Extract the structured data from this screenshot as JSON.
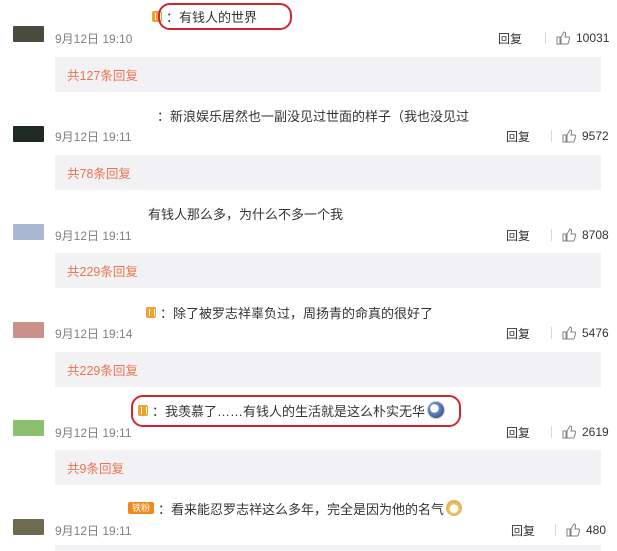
{
  "comments": [
    {
      "text": "：有钱人的世界",
      "badge": "plain",
      "emoji": null,
      "time": "9月12日 19:10",
      "reply": "回复",
      "likes": "10031",
      "more": "共127条回复",
      "avatar_color": "#4a4a3e"
    },
    {
      "text": "：新浪娱乐居然也一副没见过世面的样子（我也没见过",
      "badge": null,
      "emoji": null,
      "time": "9月12日 19:11",
      "reply": "回复",
      "likes": "9572",
      "more": "共78条回复",
      "avatar_color": "#1e2a22"
    },
    {
      "text": "有钱人那么多，为什么不多一个我",
      "badge": null,
      "emoji": null,
      "time": "9月12日 19:11",
      "reply": "回复",
      "likes": "8708",
      "more": "共229条回复",
      "avatar_color": "#a9b6d4"
    },
    {
      "text": "：除了被罗志祥辜负过，周扬青的命真的很好了",
      "badge": "plain",
      "emoji": null,
      "time": "9月12日 19:14",
      "reply": "回复",
      "likes": "5476",
      "more": "共229条回复",
      "avatar_color": "#c9918a"
    },
    {
      "text": "：我羡慕了……有钱人的生活就是这么朴实无华",
      "badge": "plain",
      "emoji": "dog",
      "time": "9月12日 19:11",
      "reply": "回复",
      "likes": "2619",
      "more": "共9条回复",
      "avatar_color": "#8cbf6e"
    },
    {
      "text": "：看来能忍罗志祥这么多年，完全是因为他的名气",
      "badge": "wide",
      "badge_text": "铁粉",
      "emoji": "shiba",
      "time": "9月12日 19:11",
      "reply": "回复",
      "likes": "480",
      "more": null,
      "avatar_color": "#6d6a4f"
    }
  ],
  "colors": {
    "link": "#eb7350",
    "highlight": "#d0252f",
    "panel": "#f2f2f5"
  }
}
